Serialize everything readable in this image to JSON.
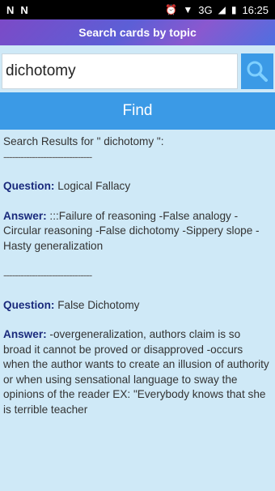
{
  "status_bar": {
    "left_icons": [
      "N",
      "N"
    ],
    "network": "3G",
    "time": "16:25"
  },
  "app": {
    "title": "Search cards by topic"
  },
  "search": {
    "value": "dichotomy"
  },
  "find_label": "Find",
  "results": {
    "header": "Search Results for \" dichotomy \":",
    "separator": "-------------------------------",
    "question_label": "Question:",
    "answer_label": "Answer:",
    "items": [
      {
        "question": "Logical Fallacy",
        "answer": ":::Failure of reasoning -False analogy -Circular reasoning -False dichotomy -Sippery slope -Hasty generalization"
      },
      {
        "question": "False Dichotomy",
        "answer": "-overgeneralization, authors claim is so broad it cannot be proved or disapproved -occurs when the author wants to create an illusion of authority or when using sensational language to sway the opinions of the reader EX: \"Everybody knows that she is terrible teacher"
      }
    ]
  },
  "colors": {
    "accent": "#3b9ae6",
    "background": "#cfe9f7",
    "label": "#1a2a7c"
  }
}
